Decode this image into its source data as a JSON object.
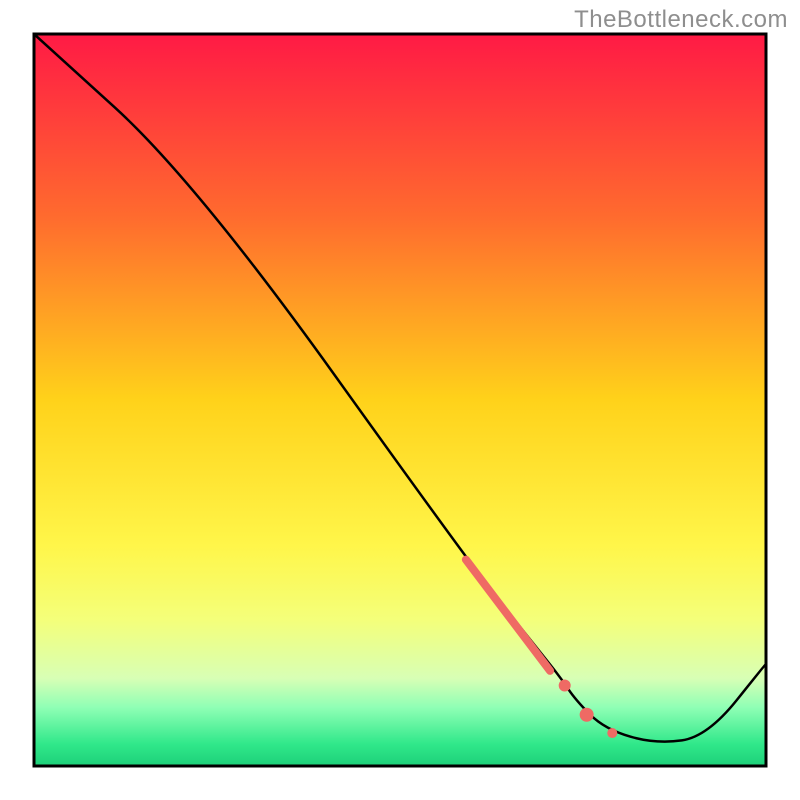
{
  "watermark": "TheBottleneck.com",
  "chart_data": {
    "type": "line",
    "xlim": [
      0,
      100
    ],
    "ylim": [
      0,
      100
    ],
    "title": "",
    "xlabel": "",
    "ylabel": "",
    "grid": false,
    "legend": false,
    "background_gradient": {
      "stops": [
        {
          "offset": 0.0,
          "color": "#ff1a45"
        },
        {
          "offset": 0.25,
          "color": "#ff6b2e"
        },
        {
          "offset": 0.5,
          "color": "#ffd21a"
        },
        {
          "offset": 0.7,
          "color": "#fff64a"
        },
        {
          "offset": 0.8,
          "color": "#f4ff7a"
        },
        {
          "offset": 0.88,
          "color": "#d8ffb5"
        },
        {
          "offset": 0.92,
          "color": "#8fffb5"
        },
        {
          "offset": 0.97,
          "color": "#30e88a"
        },
        {
          "offset": 1.0,
          "color": "#1dd079"
        }
      ]
    },
    "series": [
      {
        "name": "bottleneck-curve",
        "x": [
          0,
          22,
          60,
          68,
          72,
          74,
          78,
          85,
          92,
          100
        ],
        "y": [
          100,
          80,
          27,
          17,
          12,
          9,
          5,
          3,
          4,
          14
        ]
      }
    ],
    "markers": [
      {
        "name": "highlight-segment",
        "type": "thick-line",
        "color": "#ef6a64",
        "width": 8,
        "x": [
          59,
          70.5
        ],
        "y": [
          28.2,
          13
        ]
      },
      {
        "name": "dot-a",
        "type": "point",
        "color": "#ef6a64",
        "radius": 6,
        "x": 72.5,
        "y": 11
      },
      {
        "name": "dot-b",
        "type": "point",
        "color": "#ef6a64",
        "radius": 7,
        "x": 75.5,
        "y": 7
      },
      {
        "name": "dot-c",
        "type": "point",
        "color": "#ef6a64",
        "radius": 5,
        "x": 79,
        "y": 4.5
      }
    ]
  }
}
